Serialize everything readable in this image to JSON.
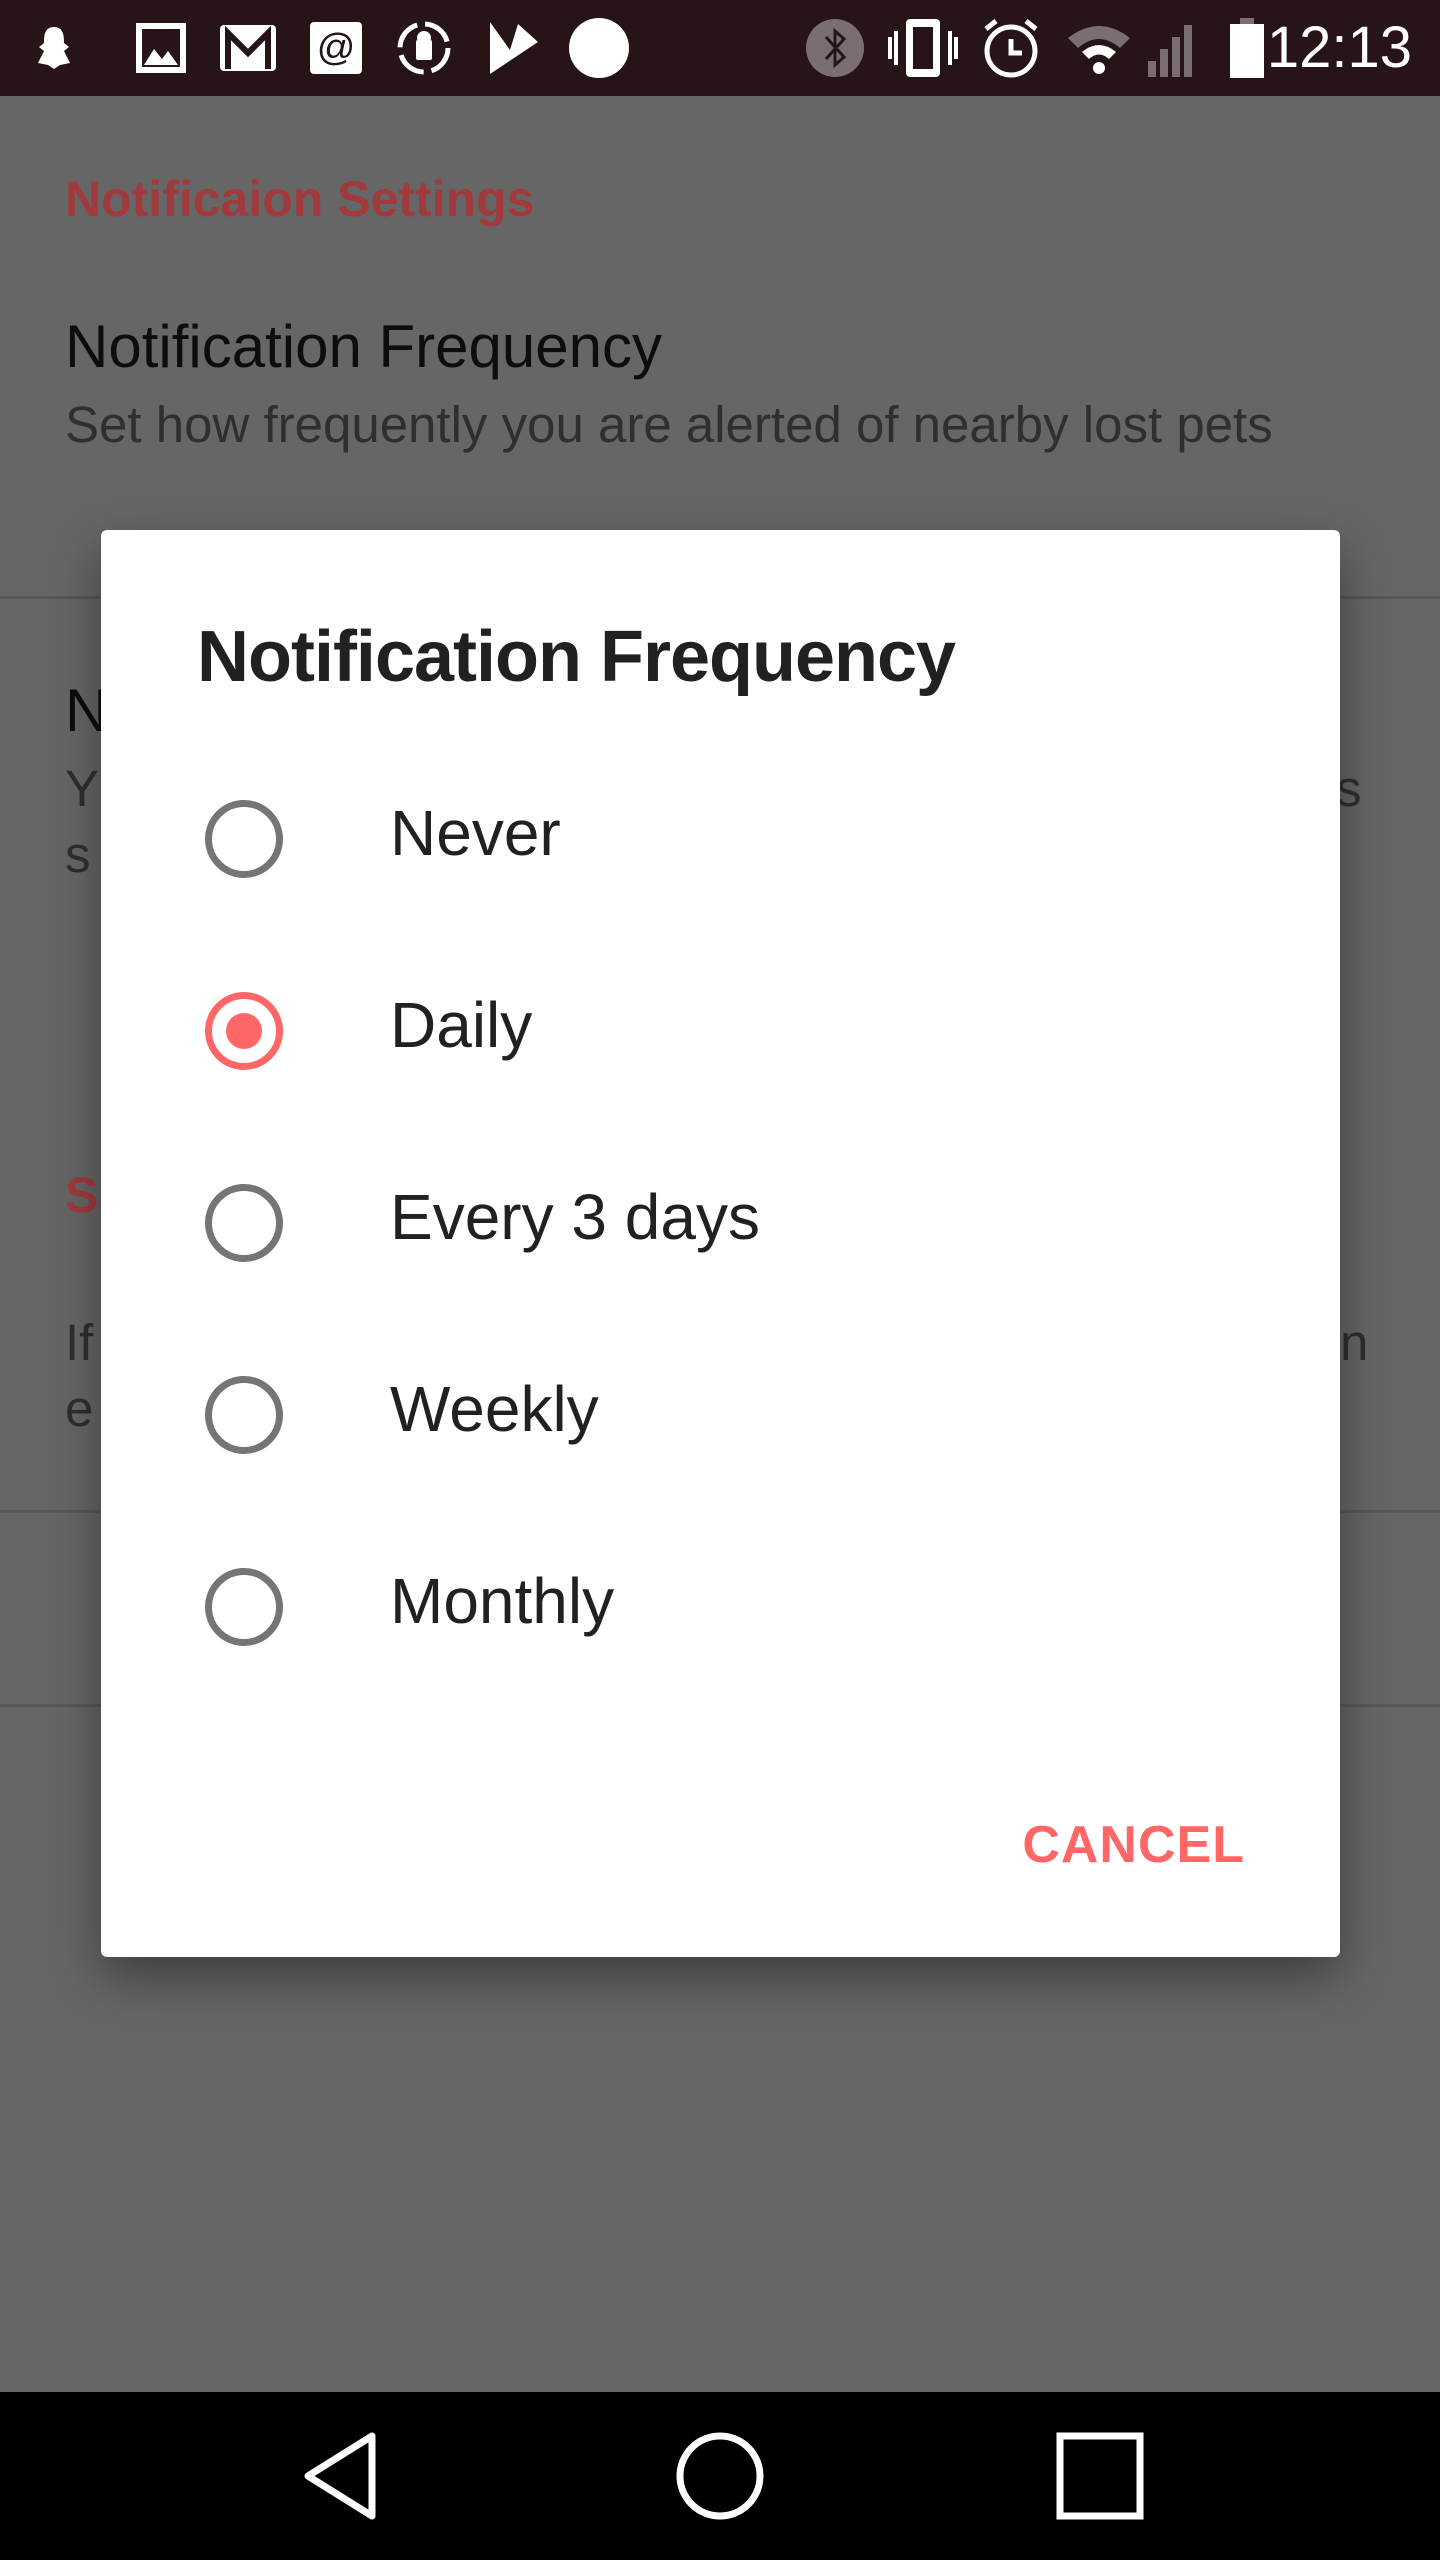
{
  "status_bar": {
    "time": "12:13",
    "left_icons": [
      "snapchat-icon",
      "gallery-icon",
      "gmail-icon",
      "email-icon",
      "android-sync-icon",
      "check-icon",
      "circle-icon"
    ],
    "right_icons": [
      "bluetooth-icon",
      "vibrate-icon",
      "alarm-icon",
      "wifi-icon",
      "signal-icon",
      "battery-icon"
    ]
  },
  "settings": {
    "section1_header": "Notificaion Settings",
    "item1_title": "Notification Frequency",
    "item1_summary": "Set how frequently you are alerted of nearby lost pets",
    "item2_title_fragment": "N",
    "item2_summary_left": [
      "Y",
      "s"
    ],
    "item2_summary_right": "s",
    "section2_header_fragment": "S",
    "item3_summary_left": [
      "If",
      "e"
    ],
    "item3_summary_right": "n"
  },
  "dialog": {
    "title": "Notification Frequency",
    "options": [
      {
        "label": "Never",
        "selected": false
      },
      {
        "label": "Daily",
        "selected": true
      },
      {
        "label": "Every 3 days",
        "selected": false
      },
      {
        "label": "Weekly",
        "selected": false
      },
      {
        "label": "Monthly",
        "selected": false
      }
    ],
    "cancel_label": "CANCEL"
  },
  "colors": {
    "accent": "#ff6666",
    "status_bar": "#261416",
    "header": "#c0393b"
  }
}
